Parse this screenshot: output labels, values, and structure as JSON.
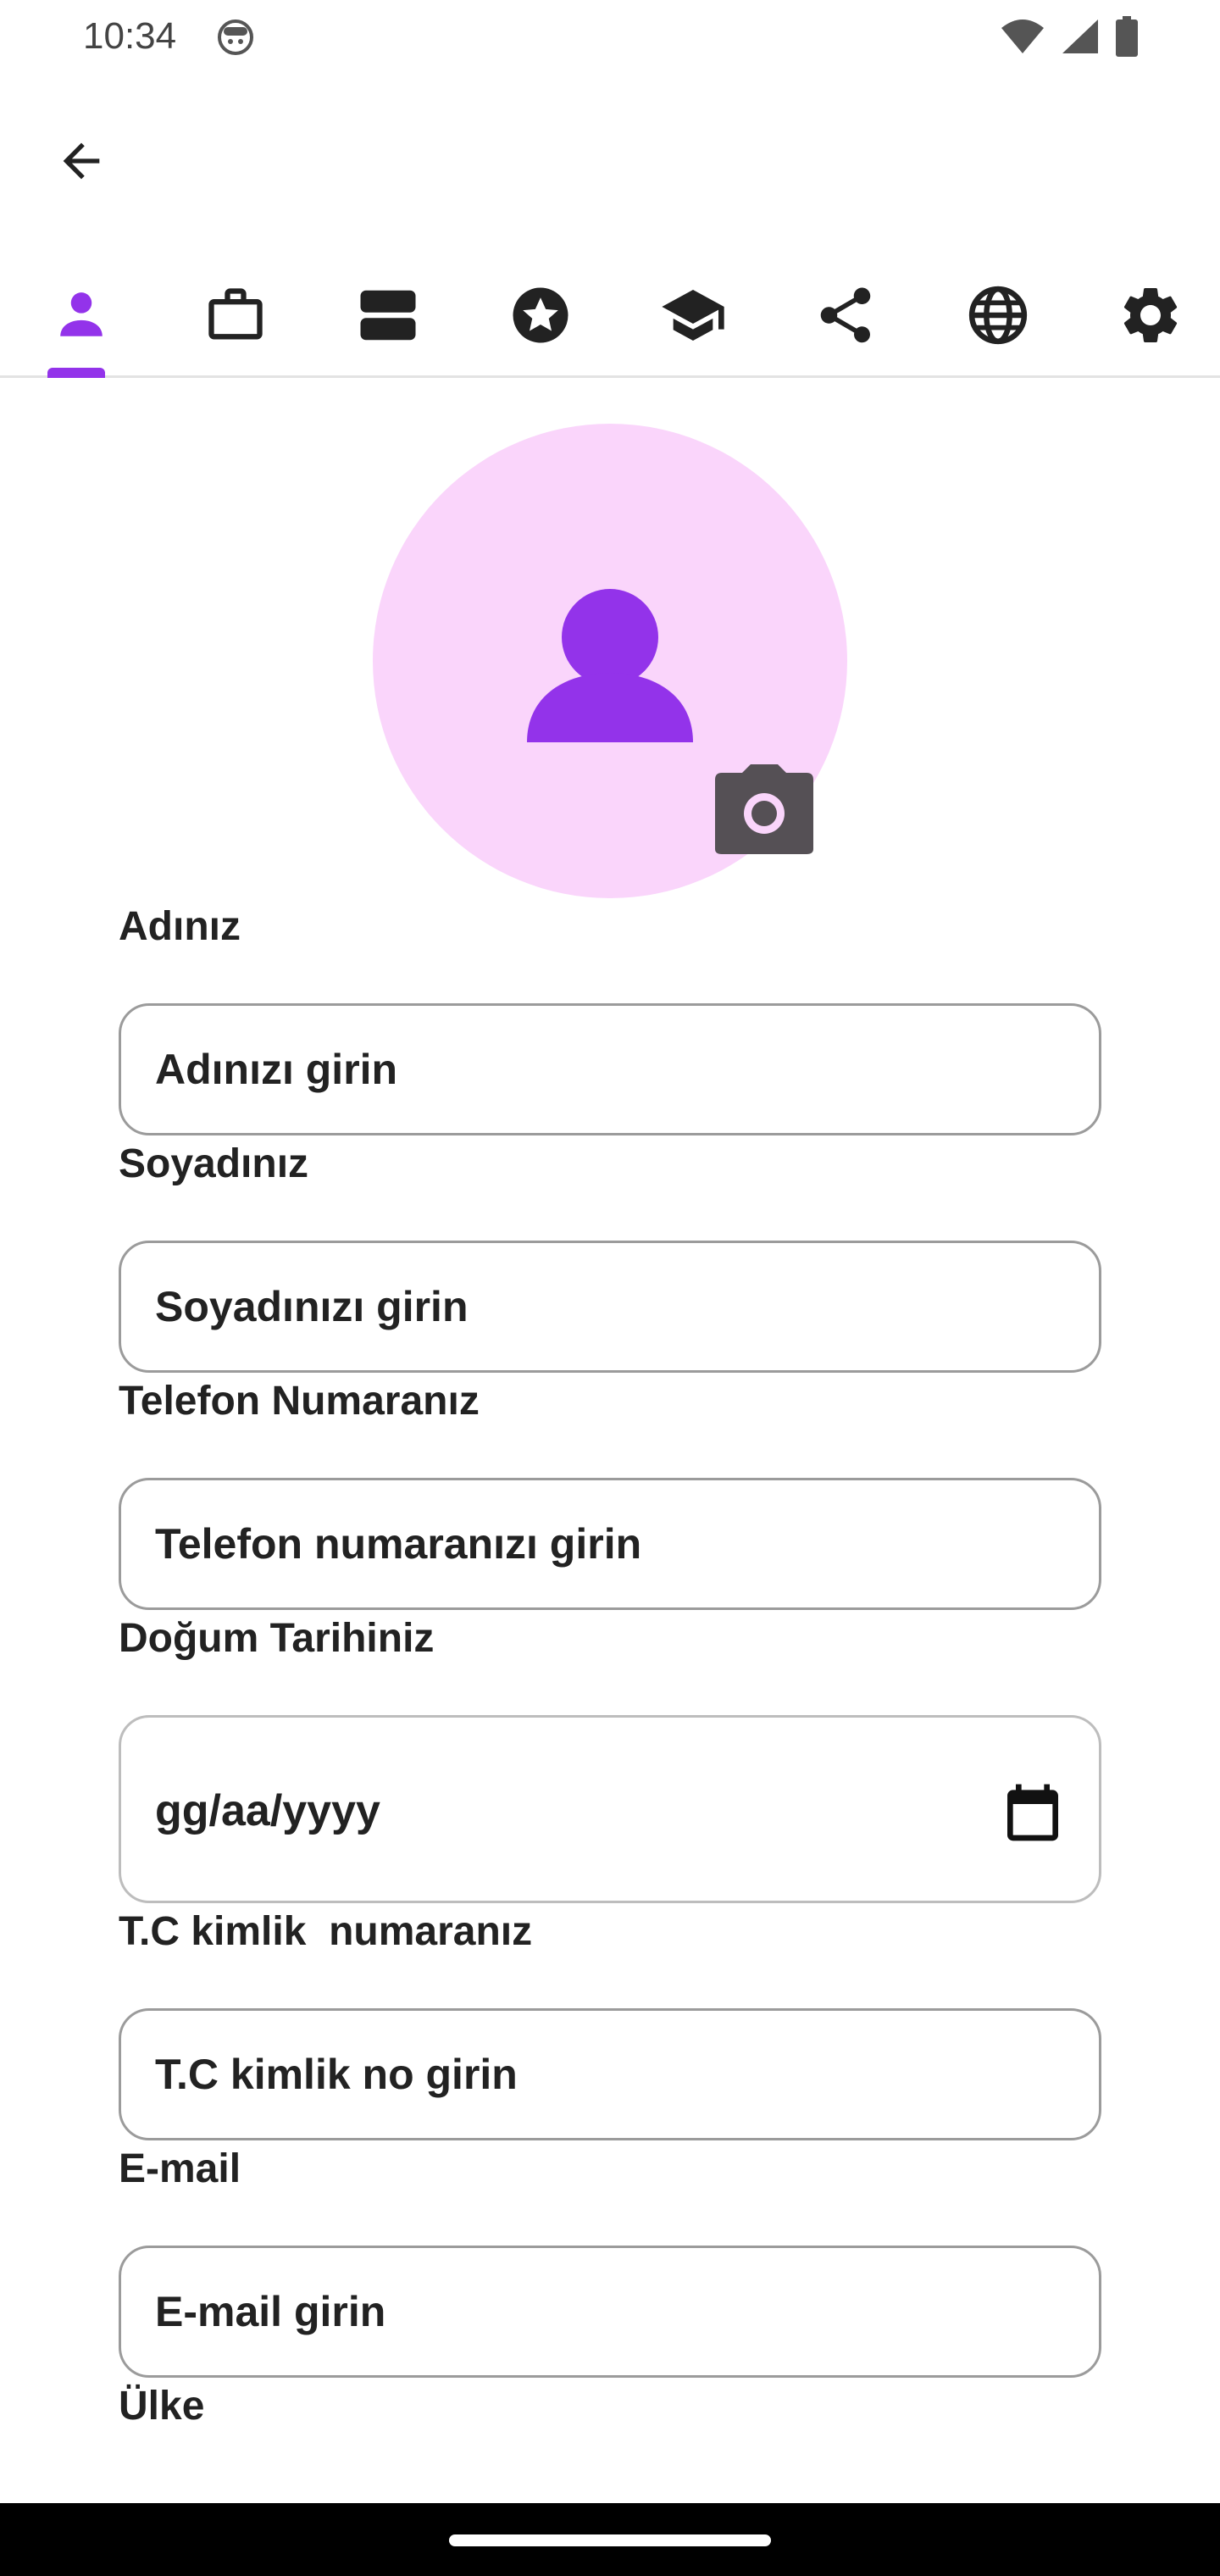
{
  "status_bar": {
    "time": "10:34",
    "icons": [
      "face-icon",
      "wifi-icon",
      "signal-icon",
      "battery-icon"
    ]
  },
  "app_bar": {
    "back_icon": "arrow-back-icon"
  },
  "tabs": [
    {
      "icon": "person-icon",
      "selected": true
    },
    {
      "icon": "briefcase-icon",
      "selected": false
    },
    {
      "icon": "storage-icon",
      "selected": false
    },
    {
      "icon": "star-icon",
      "selected": false
    },
    {
      "icon": "graduation-cap-icon",
      "selected": false
    },
    {
      "icon": "share-icon",
      "selected": false
    },
    {
      "icon": "globe-icon",
      "selected": false
    },
    {
      "icon": "settings-icon",
      "selected": false
    }
  ],
  "colors": {
    "accent": "#9333ea",
    "avatar_bg": "#fad5fb",
    "camera_bg": "#555055"
  },
  "form": {
    "first_name": {
      "label": "Adınız",
      "placeholder": "Adınızı girin"
    },
    "last_name": {
      "label": "Soyadınız",
      "placeholder": "Soyadınızı girin"
    },
    "phone": {
      "label": "Telefon Numaranız",
      "placeholder": "Telefon numaranızı girin"
    },
    "birth_date": {
      "label": "Doğum Tarihiniz",
      "placeholder": "gg/aa/yyyy"
    },
    "tc_id": {
      "label": "T.C kimlik  numaranız",
      "placeholder": "T.C kimlik no girin"
    },
    "email": {
      "label": "E-mail",
      "placeholder": "E-mail girin"
    },
    "country": {
      "label": "Ülke"
    }
  }
}
